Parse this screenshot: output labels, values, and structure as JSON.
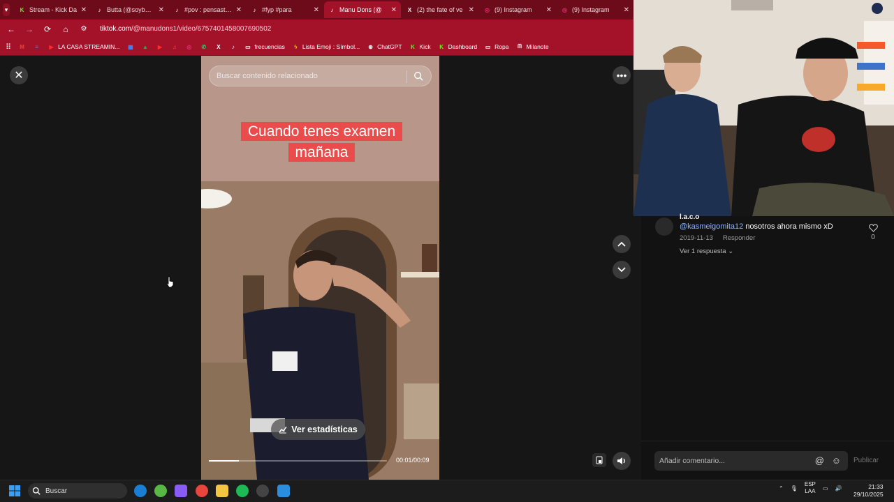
{
  "browser": {
    "tabs": [
      {
        "title": "Stream - Kick Da",
        "icon": "kick-icon",
        "color": "#53fc18",
        "active": false
      },
      {
        "title": "Butta (@soybutta",
        "icon": "tiktok-icon",
        "color": "#ffffff",
        "active": false
      },
      {
        "title": "#pov : pensaste q",
        "icon": "tiktok-icon",
        "color": "#ffffff",
        "active": false
      },
      {
        "title": "#fyp #para",
        "icon": "tiktok-icon",
        "color": "#ffffff",
        "active": false
      },
      {
        "title": "Manu Dons (@",
        "icon": "tiktok-icon",
        "color": "#ffffff",
        "active": true
      },
      {
        "title": "(2) the fate of ve",
        "icon": "x-icon",
        "color": "#ffffff",
        "active": false
      },
      {
        "title": "(9) Instagram",
        "icon": "instagram-icon",
        "color": "#e1306c",
        "active": false
      },
      {
        "title": "(9) Instagram",
        "icon": "instagram-icon",
        "color": "#e1306c",
        "active": false
      }
    ],
    "url_host": "tiktok.com",
    "url_path": "/@manudons1/video/6757401458007690502",
    "bookmarks": [
      {
        "label": "",
        "icon": "gmail-icon"
      },
      {
        "label": "",
        "icon": "docs-icon"
      },
      {
        "label": "LA CASA STREAMIN...",
        "icon": "youtube-icon"
      },
      {
        "label": "",
        "icon": "calendar-icon"
      },
      {
        "label": "",
        "icon": "drive-icon"
      },
      {
        "label": "",
        "icon": "youtube-icon"
      },
      {
        "label": "",
        "icon": "music-icon"
      },
      {
        "label": "",
        "icon": "instagram-icon"
      },
      {
        "label": "",
        "icon": "whatsapp-icon"
      },
      {
        "label": "",
        "icon": "x-icon"
      },
      {
        "label": "",
        "icon": "tiktok-icon"
      },
      {
        "label": "frecuencias",
        "icon": "folder-icon"
      },
      {
        "label": "Lista Emoji : Símbol...",
        "icon": "bolt-icon"
      },
      {
        "label": "ChatGPT",
        "icon": "chatgpt-icon"
      },
      {
        "label": "Kick",
        "icon": "kick-icon"
      },
      {
        "label": "Dashboard",
        "icon": "kick-icon"
      },
      {
        "label": "Ropa",
        "icon": "folder-icon"
      },
      {
        "label": "Milanote",
        "icon": "milanote-icon"
      }
    ]
  },
  "video": {
    "search_placeholder": "Buscar contenido relacionado",
    "caption_line1": "Cuando tenes examen",
    "caption_line2": "mañana",
    "stats_label": "Ver estadísticas",
    "time": "00:01/00:09",
    "progress": 0.17
  },
  "comment": {
    "author": "l.a.c.o",
    "mention": "@kasmeigomita12",
    "text": " nosotros ahora mismo xD",
    "date": "2019-11-13",
    "reply_label": "Responder",
    "likes": "0",
    "replies": "Ver 1 respuesta"
  },
  "comment_input": {
    "placeholder": "Añadir comentario...",
    "publish": "Publicar"
  },
  "taskbar": {
    "search": "Buscar",
    "lang_top": "ESP",
    "lang_bottom": "LAA",
    "time": "21:33",
    "date": "29/10/2025"
  }
}
